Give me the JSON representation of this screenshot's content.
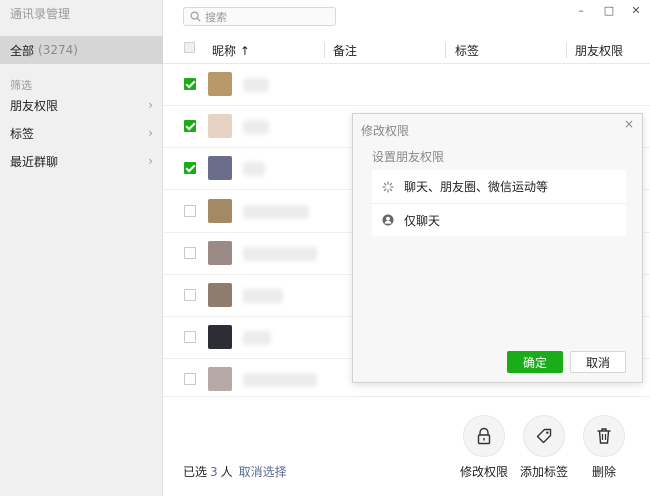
{
  "window": {
    "title": "通讯录管理",
    "controls": [
      "–",
      "□",
      "✕"
    ]
  },
  "sidebar": {
    "all_label": "全部",
    "all_count": "(3274)",
    "filter_heading": "筛选",
    "items": [
      {
        "label": "朋友权限"
      },
      {
        "label": "标签"
      },
      {
        "label": "最近群聊"
      }
    ]
  },
  "search": {
    "placeholder": "搜索"
  },
  "table": {
    "columns": [
      "昵称 ↑",
      "备注",
      "标签",
      "朋友权限"
    ],
    "rows": [
      {
        "checked": true,
        "avatar_color": "#b89a6a"
      },
      {
        "checked": true,
        "avatar_color": "#e8d2c4"
      },
      {
        "checked": true,
        "avatar_color": "#6a6e8a"
      },
      {
        "checked": false,
        "avatar_color": "#a48a64"
      },
      {
        "checked": false,
        "avatar_color": "#9c8a86"
      },
      {
        "checked": false,
        "avatar_color": "#8e7c6e"
      },
      {
        "checked": false,
        "avatar_color": "#2c2c34"
      },
      {
        "checked": false,
        "avatar_color": "#b7a9a6"
      }
    ]
  },
  "footer": {
    "selected_prefix": "已选",
    "selected_count": "3",
    "selected_suffix": "人",
    "cancel_selection": "取消选择",
    "actions": [
      {
        "label": "修改权限",
        "icon": "lock-icon"
      },
      {
        "label": "添加标签",
        "icon": "tag-icon"
      },
      {
        "label": "删除",
        "icon": "trash-icon"
      }
    ]
  },
  "dialog": {
    "title": "修改权限",
    "close": "×",
    "subtitle": "设置朋友权限",
    "options": [
      {
        "label": "聊天、朋友圈、微信运动等",
        "icon": "loading-icon"
      },
      {
        "label": "仅聊天",
        "icon": "user-icon"
      }
    ],
    "ok_label": "确定",
    "cancel_label": "取消"
  },
  "colors": {
    "accent": "#1aad19",
    "link": "#576b95"
  }
}
